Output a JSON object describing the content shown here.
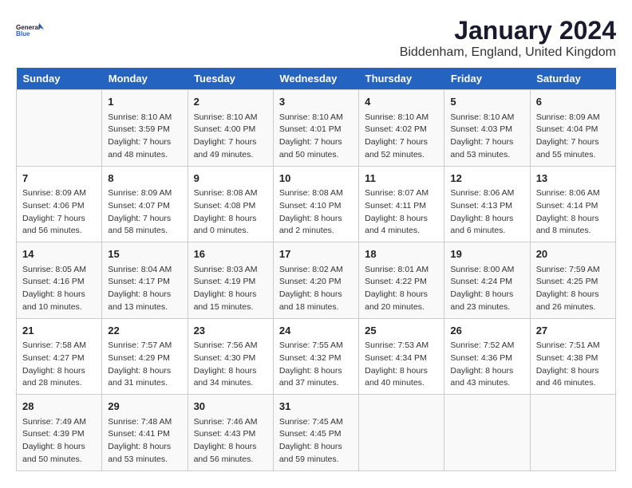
{
  "header": {
    "logo_line1": "General",
    "logo_line2": "Blue",
    "month_title": "January 2024",
    "location": "Biddenham, England, United Kingdom"
  },
  "weekdays": [
    "Sunday",
    "Monday",
    "Tuesday",
    "Wednesday",
    "Thursday",
    "Friday",
    "Saturday"
  ],
  "weeks": [
    [
      {
        "day": "",
        "content": ""
      },
      {
        "day": "1",
        "content": "Sunrise: 8:10 AM\nSunset: 3:59 PM\nDaylight: 7 hours\nand 48 minutes."
      },
      {
        "day": "2",
        "content": "Sunrise: 8:10 AM\nSunset: 4:00 PM\nDaylight: 7 hours\nand 49 minutes."
      },
      {
        "day": "3",
        "content": "Sunrise: 8:10 AM\nSunset: 4:01 PM\nDaylight: 7 hours\nand 50 minutes."
      },
      {
        "day": "4",
        "content": "Sunrise: 8:10 AM\nSunset: 4:02 PM\nDaylight: 7 hours\nand 52 minutes."
      },
      {
        "day": "5",
        "content": "Sunrise: 8:10 AM\nSunset: 4:03 PM\nDaylight: 7 hours\nand 53 minutes."
      },
      {
        "day": "6",
        "content": "Sunrise: 8:09 AM\nSunset: 4:04 PM\nDaylight: 7 hours\nand 55 minutes."
      }
    ],
    [
      {
        "day": "7",
        "content": "Sunrise: 8:09 AM\nSunset: 4:06 PM\nDaylight: 7 hours\nand 56 minutes."
      },
      {
        "day": "8",
        "content": "Sunrise: 8:09 AM\nSunset: 4:07 PM\nDaylight: 7 hours\nand 58 minutes."
      },
      {
        "day": "9",
        "content": "Sunrise: 8:08 AM\nSunset: 4:08 PM\nDaylight: 8 hours\nand 0 minutes."
      },
      {
        "day": "10",
        "content": "Sunrise: 8:08 AM\nSunset: 4:10 PM\nDaylight: 8 hours\nand 2 minutes."
      },
      {
        "day": "11",
        "content": "Sunrise: 8:07 AM\nSunset: 4:11 PM\nDaylight: 8 hours\nand 4 minutes."
      },
      {
        "day": "12",
        "content": "Sunrise: 8:06 AM\nSunset: 4:13 PM\nDaylight: 8 hours\nand 6 minutes."
      },
      {
        "day": "13",
        "content": "Sunrise: 8:06 AM\nSunset: 4:14 PM\nDaylight: 8 hours\nand 8 minutes."
      }
    ],
    [
      {
        "day": "14",
        "content": "Sunrise: 8:05 AM\nSunset: 4:16 PM\nDaylight: 8 hours\nand 10 minutes."
      },
      {
        "day": "15",
        "content": "Sunrise: 8:04 AM\nSunset: 4:17 PM\nDaylight: 8 hours\nand 13 minutes."
      },
      {
        "day": "16",
        "content": "Sunrise: 8:03 AM\nSunset: 4:19 PM\nDaylight: 8 hours\nand 15 minutes."
      },
      {
        "day": "17",
        "content": "Sunrise: 8:02 AM\nSunset: 4:20 PM\nDaylight: 8 hours\nand 18 minutes."
      },
      {
        "day": "18",
        "content": "Sunrise: 8:01 AM\nSunset: 4:22 PM\nDaylight: 8 hours\nand 20 minutes."
      },
      {
        "day": "19",
        "content": "Sunrise: 8:00 AM\nSunset: 4:24 PM\nDaylight: 8 hours\nand 23 minutes."
      },
      {
        "day": "20",
        "content": "Sunrise: 7:59 AM\nSunset: 4:25 PM\nDaylight: 8 hours\nand 26 minutes."
      }
    ],
    [
      {
        "day": "21",
        "content": "Sunrise: 7:58 AM\nSunset: 4:27 PM\nDaylight: 8 hours\nand 28 minutes."
      },
      {
        "day": "22",
        "content": "Sunrise: 7:57 AM\nSunset: 4:29 PM\nDaylight: 8 hours\nand 31 minutes."
      },
      {
        "day": "23",
        "content": "Sunrise: 7:56 AM\nSunset: 4:30 PM\nDaylight: 8 hours\nand 34 minutes."
      },
      {
        "day": "24",
        "content": "Sunrise: 7:55 AM\nSunset: 4:32 PM\nDaylight: 8 hours\nand 37 minutes."
      },
      {
        "day": "25",
        "content": "Sunrise: 7:53 AM\nSunset: 4:34 PM\nDaylight: 8 hours\nand 40 minutes."
      },
      {
        "day": "26",
        "content": "Sunrise: 7:52 AM\nSunset: 4:36 PM\nDaylight: 8 hours\nand 43 minutes."
      },
      {
        "day": "27",
        "content": "Sunrise: 7:51 AM\nSunset: 4:38 PM\nDaylight: 8 hours\nand 46 minutes."
      }
    ],
    [
      {
        "day": "28",
        "content": "Sunrise: 7:49 AM\nSunset: 4:39 PM\nDaylight: 8 hours\nand 50 minutes."
      },
      {
        "day": "29",
        "content": "Sunrise: 7:48 AM\nSunset: 4:41 PM\nDaylight: 8 hours\nand 53 minutes."
      },
      {
        "day": "30",
        "content": "Sunrise: 7:46 AM\nSunset: 4:43 PM\nDaylight: 8 hours\nand 56 minutes."
      },
      {
        "day": "31",
        "content": "Sunrise: 7:45 AM\nSunset: 4:45 PM\nDaylight: 8 hours\nand 59 minutes."
      },
      {
        "day": "",
        "content": ""
      },
      {
        "day": "",
        "content": ""
      },
      {
        "day": "",
        "content": ""
      }
    ]
  ]
}
